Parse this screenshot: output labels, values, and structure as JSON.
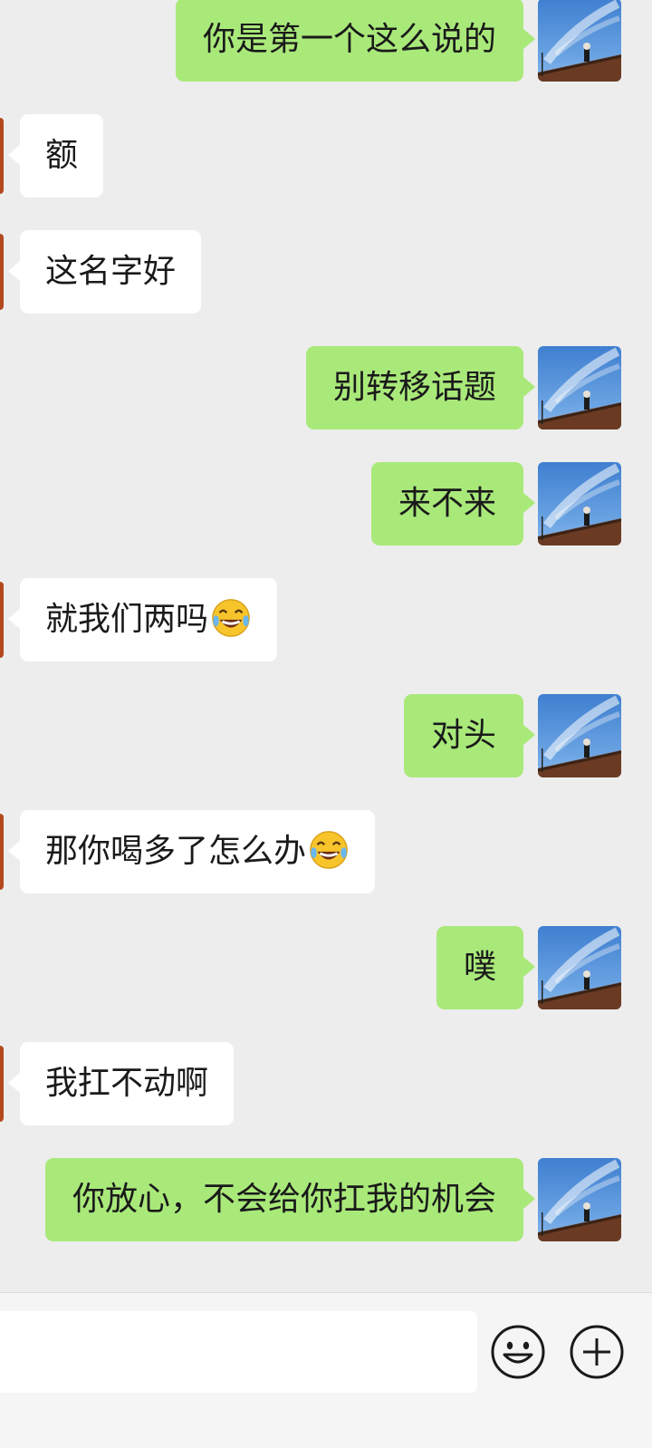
{
  "colors": {
    "background": "#ededed",
    "outgoing_bubble": "#a9e97a",
    "incoming_bubble": "#ffffff",
    "input_bar": "#f5f5f5"
  },
  "messages": [
    {
      "direction": "outgoing",
      "text": "你是第一个这么说的"
    },
    {
      "direction": "incoming",
      "text": "额"
    },
    {
      "direction": "incoming",
      "text": "这名字好"
    },
    {
      "direction": "outgoing",
      "text": "别转移话题"
    },
    {
      "direction": "outgoing",
      "text": "来不来"
    },
    {
      "direction": "incoming",
      "text": "就我们两吗",
      "emoji": "tears-of-joy-emoji"
    },
    {
      "direction": "outgoing",
      "text": "对头"
    },
    {
      "direction": "incoming",
      "text": "那你喝多了怎么办",
      "emoji": "tears-of-joy-emoji"
    },
    {
      "direction": "outgoing",
      "text": "噗"
    },
    {
      "direction": "incoming",
      "text": "我扛不动啊"
    },
    {
      "direction": "outgoing",
      "text": "你放心，不会给你扛我的机会"
    }
  ],
  "input_bar": {
    "message_input_value": "",
    "icons": [
      "smiley-face-icon",
      "plus-circle-icon"
    ]
  }
}
